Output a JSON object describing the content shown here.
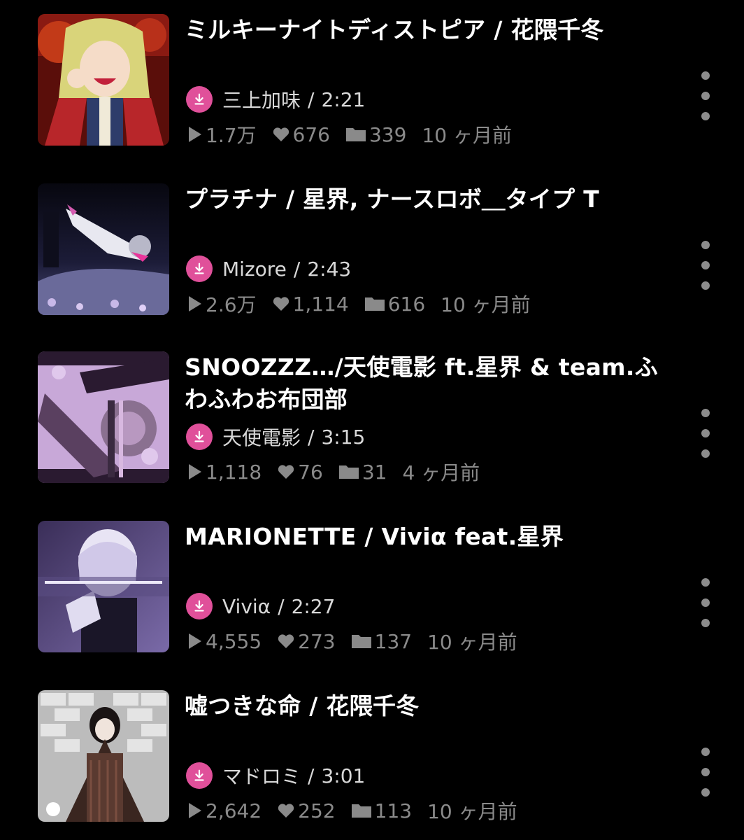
{
  "colors": {
    "accent": "#e0509a",
    "background": "#000000",
    "stat_gray": "#8a8a8a"
  },
  "items": [
    {
      "title": "ミルキーナイトディストピア / 花隈千冬",
      "uploader": "三上加味",
      "duration": "2:21",
      "plays": "1.7万",
      "likes": "676",
      "mylists": "339",
      "posted": "10 ヶ月前"
    },
    {
      "title": "プラチナ / 星界, ナースロボ＿タイプ T",
      "uploader": "Mizore",
      "duration": "2:43",
      "plays": "2.6万",
      "likes": "1,114",
      "mylists": "616",
      "posted": "10 ヶ月前"
    },
    {
      "title": "SNOOZZZ…/天使電影 ft.星界 & team.ふわふわお布団部",
      "uploader": "天使電影",
      "duration": "3:15",
      "plays": "1,118",
      "likes": "76",
      "mylists": "31",
      "posted": "4 ヶ月前"
    },
    {
      "title": "MARIONETTE / Viviα feat.星界",
      "uploader": "Viviα",
      "duration": "2:27",
      "plays": "4,555",
      "likes": "273",
      "mylists": "137",
      "posted": "10 ヶ月前"
    },
    {
      "title": "嘘つきな命 / 花隈千冬",
      "uploader": "マドロミ",
      "duration": "3:01",
      "plays": "2,642",
      "likes": "252",
      "mylists": "113",
      "posted": "10 ヶ月前"
    }
  ],
  "icons": {
    "download": "download-icon",
    "play": "play-icon",
    "like": "heart-icon",
    "mylist": "folder-icon",
    "menu": "more-vertical-icon"
  }
}
